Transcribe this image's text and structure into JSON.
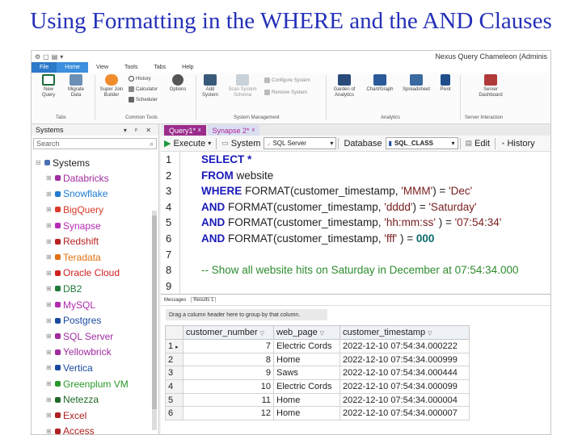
{
  "slide_title": "Using Formatting in the WHERE and the AND Clauses",
  "app": {
    "title": "Nexus Query Chameleon (Adminis",
    "qat_icons": [
      "gear-icon",
      "page-icon",
      "save-icon",
      "dropdown-icon"
    ]
  },
  "ribbon_tabs": [
    "File",
    "Home",
    "View",
    "Tools",
    "Tabs",
    "Help"
  ],
  "ribbon": {
    "new_query": "New\nQuery",
    "migrate_data": "Migrate\nData",
    "super_join": "Super Join\nBuilder",
    "history": "History",
    "calculator": "Calculator",
    "scheduler": "Scheduler",
    "options": "Options",
    "add_system": "Add\nSystem",
    "scan_system": "Scan System\nSchema",
    "configure_system": "Configure System",
    "remove_system": "Remove System",
    "garden": "Garden of\nAnalytics",
    "chart_graph": "Chart/Graph",
    "spreadsheet": "Spreadsheet",
    "pivot": "Pivot",
    "server_dashboard": "Server\nDashboard",
    "groups": [
      "Tabs",
      "Common Tools",
      "System Management",
      "Analytics",
      "Server Interaction"
    ]
  },
  "left_panel": {
    "title": "Systems",
    "controls": "▾ ᵖ ✕",
    "search_placeholder": "Search",
    "root": "Systems",
    "items": [
      {
        "label": "Databricks",
        "color": "#a02ca0"
      },
      {
        "label": "Snowflake",
        "color": "#1e7bd0"
      },
      {
        "label": "BigQuery",
        "color": "#d93a2a"
      },
      {
        "label": "Synapse",
        "color": "#b62ab6"
      },
      {
        "label": "Redshift",
        "color": "#b82020"
      },
      {
        "label": "Teradata",
        "color": "#e07010"
      },
      {
        "label": "Oracle Cloud",
        "color": "#d02020"
      },
      {
        "label": "DB2",
        "color": "#1f7a3a"
      },
      {
        "label": "MySQL",
        "color": "#b02cb0"
      },
      {
        "label": "Postgres",
        "color": "#1a4aa0"
      },
      {
        "label": "SQL Server",
        "color": "#a02ca0"
      },
      {
        "label": "Yellowbrick",
        "color": "#a02ca0"
      },
      {
        "label": "Vertica",
        "color": "#1a4aa0"
      },
      {
        "label": "Greenplum VM",
        "color": "#2a9a2a"
      },
      {
        "label": "Netezza",
        "color": "#1f6a2a"
      },
      {
        "label": "Excel",
        "color": "#b02020"
      },
      {
        "label": "Access",
        "color": "#b02020"
      }
    ]
  },
  "doc_tabs": [
    {
      "label": "Query1*",
      "close": "x"
    },
    {
      "label": "Synapse 2*",
      "close": "x"
    }
  ],
  "query_toolbar": {
    "execute": "Execute",
    "system": "System",
    "system_value": "SQL Server",
    "database": "Database",
    "database_value": "SQL_CLASS",
    "edit": "Edit",
    "history": "History"
  },
  "editor": {
    "line_numbers": [
      "1",
      "2",
      "3",
      "4",
      "5",
      "6",
      "7",
      "8",
      "9"
    ],
    "lines": [
      [
        {
          "t": "SELECT",
          "c": "kw"
        },
        {
          "t": " *",
          "c": "kw"
        }
      ],
      [
        {
          "t": "FROM",
          "c": "kw"
        },
        {
          "t": " website",
          "c": ""
        }
      ],
      [
        {
          "t": "WHERE",
          "c": "kw"
        },
        {
          "t": " FORMAT(customer_timestamp, ",
          "c": ""
        },
        {
          "t": "'MMM'",
          "c": "str"
        },
        {
          "t": ") = ",
          "c": ""
        },
        {
          "t": "'Dec'",
          "c": "str"
        }
      ],
      [
        {
          "t": "AND",
          "c": "kw"
        },
        {
          "t": " FORMAT(customer_timestamp, ",
          "c": ""
        },
        {
          "t": "'dddd'",
          "c": "str"
        },
        {
          "t": ") = ",
          "c": ""
        },
        {
          "t": "'Saturday'",
          "c": "str"
        }
      ],
      [
        {
          "t": "AND",
          "c": "kw"
        },
        {
          "t": " FORMAT(customer_timestamp, ",
          "c": ""
        },
        {
          "t": "'hh:mm:ss'",
          "c": "str"
        },
        {
          "t": " ) = ",
          "c": ""
        },
        {
          "t": "'07:54:34'",
          "c": "str"
        }
      ],
      [
        {
          "t": "AND",
          "c": "kw"
        },
        {
          "t": " FORMAT(customer_timestamp, ",
          "c": ""
        },
        {
          "t": "'fff'",
          "c": "str"
        },
        {
          "t": " ) = ",
          "c": ""
        },
        {
          "t": "000",
          "c": "num"
        }
      ],
      [],
      [
        {
          "t": "-- Show all website hits on Saturday in December at 07:54:34.000",
          "c": "cm"
        }
      ],
      []
    ]
  },
  "results": {
    "tabs": [
      "Messages",
      "Results 1"
    ],
    "drag_hint": "Drag a column header here to group by that column.",
    "columns": [
      "customer_number",
      "web_page",
      "customer_timestamp"
    ],
    "rows": [
      {
        "n": "1",
        "cursor": "▸",
        "cells": [
          "7",
          "Electric Cords",
          "2022-12-10 07:54:34.000222"
        ]
      },
      {
        "n": "2",
        "cursor": "",
        "cells": [
          "8",
          "Home",
          "2022-12-10 07:54:34.000999"
        ]
      },
      {
        "n": "3",
        "cursor": "",
        "cells": [
          "9",
          "Saws",
          "2022-12-10 07:54:34.000444"
        ]
      },
      {
        "n": "4",
        "cursor": "",
        "cells": [
          "10",
          "Electric Cords",
          "2022-12-10 07:54:34.000099"
        ]
      },
      {
        "n": "5",
        "cursor": "",
        "cells": [
          "11",
          "Home",
          "2022-12-10 07:54:34.000004"
        ]
      },
      {
        "n": "6",
        "cursor": "",
        "cells": [
          "12",
          "Home",
          "2022-12-10 07:54:34.000007"
        ]
      }
    ]
  }
}
